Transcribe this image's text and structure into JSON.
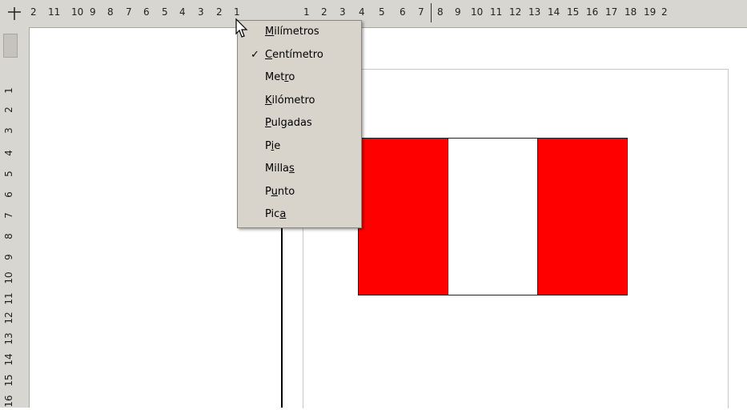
{
  "rulers": {
    "corner_icon": "ruler-corner-icon",
    "horizontal_ticks": [
      "2",
      "11",
      "10",
      "9",
      "8",
      "7",
      "6",
      "5",
      "4",
      "3",
      "2",
      "1",
      "1",
      "2",
      "3",
      "4",
      "5",
      "6",
      "7",
      "8",
      "9",
      "10",
      "11",
      "12",
      "13",
      "14",
      "15",
      "16",
      "17",
      "18",
      "19",
      "2"
    ],
    "vertical_ticks": [
      "1",
      "1",
      "2",
      "3",
      "4",
      "5",
      "6",
      "7",
      "8",
      "9",
      "10",
      "11",
      "12",
      "13",
      "14",
      "15",
      "16"
    ]
  },
  "context_menu": {
    "items": [
      {
        "pre": "",
        "u": "M",
        "post": "ilímetros",
        "checked": false
      },
      {
        "pre": "",
        "u": "C",
        "post": "entímetro",
        "checked": true
      },
      {
        "pre": "Met",
        "u": "r",
        "post": "o",
        "checked": false
      },
      {
        "pre": "",
        "u": "K",
        "post": "ilómetro",
        "checked": false
      },
      {
        "pre": "",
        "u": "P",
        "post": "ulgadas",
        "checked": false
      },
      {
        "pre": "P",
        "u": "i",
        "post": "e",
        "checked": false
      },
      {
        "pre": "Milla",
        "u": "s",
        "post": "",
        "checked": false
      },
      {
        "pre": "P",
        "u": "u",
        "post": "nto",
        "checked": false
      },
      {
        "pre": "Pic",
        "u": "a",
        "post": "",
        "checked": false
      }
    ],
    "check_mark": "✓"
  },
  "flag": {
    "colors": [
      "#ff0000",
      "#ffffff",
      "#ff0000"
    ]
  }
}
